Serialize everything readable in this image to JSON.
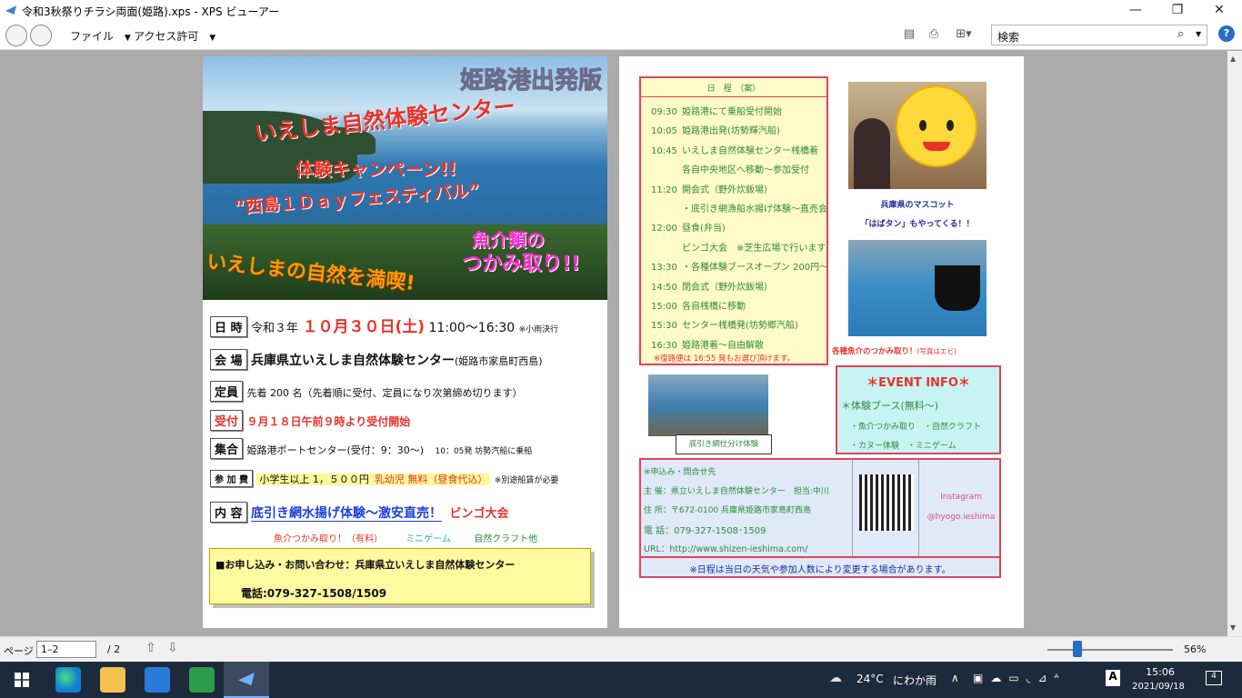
{
  "window": {
    "title": "令和3秋祭りチラシ両面(姫路).xps - XPS ビューアー"
  },
  "menu": {
    "file": "ファイル",
    "access": "アクセス許可"
  },
  "search": {
    "placeholder": "検索"
  },
  "page1": {
    "corner": "姫路港出発版",
    "title1": "いえしま自然体験センター",
    "title2": "体験キャンペーン!!",
    "title3": "“西島１Ｄａｙフェスティバル”",
    "catch1": "魚介類の",
    "catch2": "つかみ取り!!",
    "catch3": "いえしまの自然を満喫!",
    "date_label": "日 時",
    "date_pre": "令和３年",
    "date_main": "１０月３０日(土)",
    "date_time": "11:00〜16:30",
    "date_note": "※小雨決行",
    "venue_label": "会 場",
    "venue": "兵庫県立いえしま自然体験センター",
    "venue_sub": "(姫路市家島町西島)",
    "cap_label": "定員",
    "cap": "先着 200 名（先着順に受付、定員になり次第締め切ります）",
    "recep_label": "受付",
    "recep": "９月１８日午前９時より受付開始",
    "meet_label": "集合",
    "meet": "姫路港ポートセンター(受付：9：30〜)",
    "meet_sub": "10：05発 坊勢汽船に乗船",
    "fee_label": "参 加 費",
    "fee1": "小学生以上 1，５００円",
    "fee2": "乳幼児 無料（昼食代込）",
    "fee_note": "※別途船賃が必要",
    "content_label": "内 容",
    "content": "底引き網水揚げ体験〜激安直売！",
    "content2": "ビンゴ大会",
    "sub1": "魚介つかみ取り！（有料）",
    "sub2": "ミニゲーム",
    "sub3": "自然クラフト他",
    "contact1": "■お申し込み・お問い合わせ：兵庫県立いえしま自然体験センター",
    "contact2": "電話:079-327-1508/1509"
  },
  "page2": {
    "sch_title": "日　程　（案）",
    "schedule": [
      {
        "t": "09:30",
        "d": "姫路港にて乗船受付開始"
      },
      {
        "t": "10:05",
        "d": "姫路港出発(坊勢輝汽船)"
      },
      {
        "t": "10:45",
        "d": "いえしま自然体験センター桟橋着"
      },
      {
        "t": "",
        "d": "各自中央地区へ移動〜参加受付"
      },
      {
        "t": "11:20",
        "d": "開会式（野外炊飯場）"
      },
      {
        "t": "",
        "d": "・底引き網漁船水揚げ体験〜直売会"
      },
      {
        "t": "12:00",
        "d": "昼食(弁当)"
      },
      {
        "t": "",
        "d": "ビンゴ大会　※芝生広場で行います"
      },
      {
        "t": "13:30",
        "d": "・各種体験ブースオープン 200円〜"
      },
      {
        "t": "14:50",
        "d": "閉会式（野外炊飯場）"
      },
      {
        "t": "15:00",
        "d": "各自桟橋に移動"
      },
      {
        "t": "15:30",
        "d": "センター桟橋発(坊勢郷汽船)"
      },
      {
        "t": "16:30",
        "d": "姫路港着〜自由解散"
      }
    ],
    "sch_note": "※復路便は 16:55 発もお選び頂けます。",
    "mascot1": "兵庫県のマスコット",
    "mascot2": "「はばタン」もやってくる！！",
    "catch_caption": "各種魚介のつかみ取り！",
    "catch_caption2": "(写真はエビ)",
    "net_caption": "底引き網仕分け体験",
    "event_title": "＊EVENT INFO＊",
    "event1": "＊体験ブース(無料〜)",
    "event2": "・魚介つかみ取り　・自然クラフト",
    "event3": "・カヌー体験　・ミニゲーム",
    "c_head": "※申込み・問合せ先",
    "c1": "主 催：県立いえしま自然体験センター　担当:中川",
    "c2": "住 所：〒672-0100 兵庫県姫路市家島町西島",
    "c3": "電 話：079-327-1508･1509",
    "c4": "URL：http://www.shizen-ieshima.com/",
    "insta1": "Instagram",
    "insta2": "@hyogo.ieshima",
    "c_note": "※日程は当日の天気や参加人数により変更する場合があります。"
  },
  "status": {
    "page_label": "ページ",
    "page_value": "1–2",
    "page_total": "/ 2",
    "zoom": "56%"
  },
  "taskbar": {
    "temp": "24°C",
    "weather": "にわか雨",
    "time": "15:06",
    "date": "2021/09/18",
    "badge": "4"
  }
}
